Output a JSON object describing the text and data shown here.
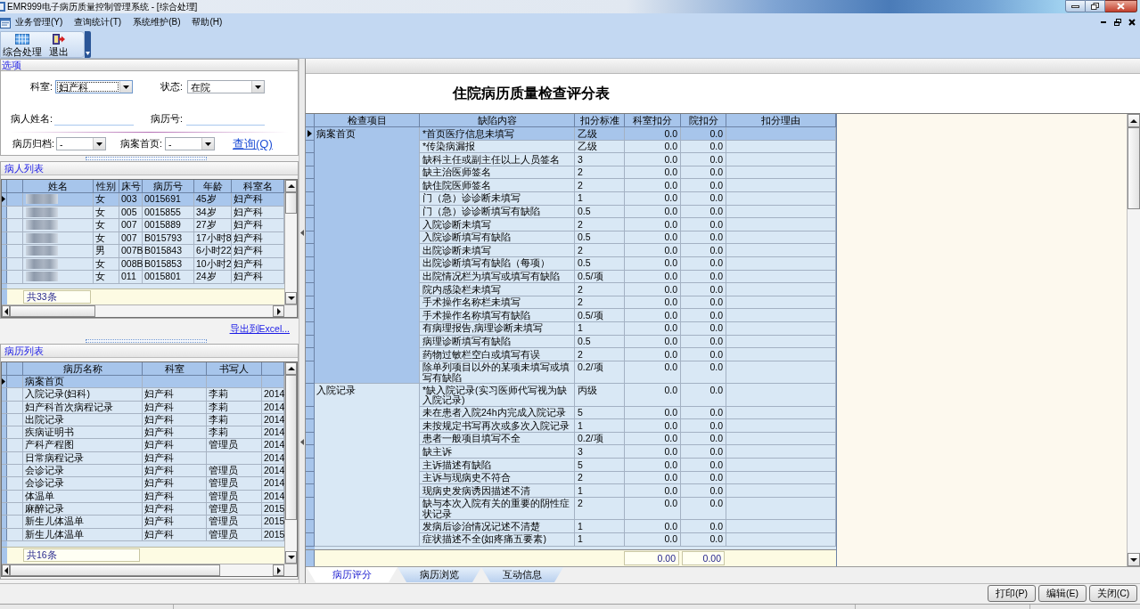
{
  "window": {
    "title": "EMR999电子病历质量控制管理系统 - [综合处理]"
  },
  "menu": [
    "业务管理(Y)",
    "查询统计(T)",
    "系统维护(B)",
    "帮助(H)"
  ],
  "toolbar": [
    {
      "kind": "grid",
      "label": "综合处理"
    },
    {
      "kind": "exit",
      "label": "退出"
    }
  ],
  "options": {
    "title": "选项",
    "dropdowns": [
      {
        "label": "科室:",
        "value": "妇产科",
        "focused": true
      },
      {
        "label": "状态:",
        "value": "在院",
        "focused": false
      },
      {
        "label": "病历归档:",
        "value": "-",
        "focused": false
      },
      {
        "label": "病案首页:",
        "value": "-",
        "focused": false
      }
    ],
    "text_fields": [
      {
        "label": "病人姓名:"
      },
      {
        "label": "病历号:"
      }
    ],
    "query_link": "查询(Q)"
  },
  "patient_list": {
    "title": "病人列表",
    "columns": [
      "姓名",
      "性别",
      "床号",
      "病历号",
      "年龄",
      "科室名"
    ],
    "rows": [
      {
        "name_blurred": true,
        "gender": "女",
        "bed": "003",
        "record_no": "0015691",
        "age": "45岁",
        "department": "妇产科",
        "selected": true
      },
      {
        "name_blurred": true,
        "gender": "女",
        "bed": "005",
        "record_no": "0015855",
        "age": "34岁",
        "department": "妇产科",
        "selected": false
      },
      {
        "name_blurred": true,
        "gender": "女",
        "bed": "007",
        "record_no": "0015889",
        "age": "27岁",
        "department": "妇产科",
        "selected": false
      },
      {
        "name_blurred": true,
        "gender": "女",
        "bed": "007",
        "record_no": "B015793",
        "age": "17小时8",
        "department": "妇产科",
        "selected": false
      },
      {
        "name_blurred": true,
        "gender": "男",
        "bed": "007B",
        "record_no": "B015843",
        "age": "6小时22",
        "department": "妇产科",
        "selected": false
      },
      {
        "name_blurred": true,
        "gender": "女",
        "bed": "008B",
        "record_no": "B015853",
        "age": "10小时2",
        "department": "妇产科",
        "selected": false
      },
      {
        "name_blurred": true,
        "gender": "女",
        "bed": "011",
        "record_no": "0015801",
        "age": "24岁",
        "department": "妇产科",
        "selected": false
      }
    ],
    "count": "共33条"
  },
  "export_link": "导出到Excel...",
  "record_list": {
    "title": "病历列表",
    "columns": [
      "病历名称",
      "科室",
      "书写人"
    ],
    "rows": [
      {
        "name": "病案首页",
        "selected": true
      },
      {
        "name": "入院记录(妇科)",
        "department": "妇产科",
        "writer": "李莉",
        "column_4": "2014",
        "selected": false
      },
      {
        "name": "妇产科首次病程记录",
        "department": "妇产科",
        "writer": "李莉",
        "column_4": "2014",
        "selected": false
      },
      {
        "name": "出院记录",
        "department": "妇产科",
        "writer": "李莉",
        "column_4": "2014",
        "selected": false
      },
      {
        "name": "疾病证明书",
        "department": "妇产科",
        "writer": "李莉",
        "column_4": "2014",
        "selected": false
      },
      {
        "name": "产科产程图",
        "department": "妇产科",
        "writer": "管理员",
        "column_4": "2014",
        "selected": false
      },
      {
        "name": "日常病程记录",
        "department": "妇产科",
        "column_4": "2014",
        "selected": false
      },
      {
        "name": "会诊记录",
        "department": "妇产科",
        "writer": "管理员",
        "column_4": "2014",
        "selected": false
      },
      {
        "name": "会诊记录",
        "department": "妇产科",
        "writer": "管理员",
        "column_4": "2014",
        "selected": false
      },
      {
        "name": "体温单",
        "department": "妇产科",
        "writer": "管理员",
        "column_4": "2014",
        "selected": false
      },
      {
        "name": "麻醉记录",
        "department": "妇产科",
        "writer": "管理员",
        "column_4": "2015",
        "selected": false
      },
      {
        "name": "新生儿体温单",
        "department": "妇产科",
        "writer": "管理员",
        "column_4": "2015",
        "selected": false
      },
      {
        "name": "新生儿体温单",
        "department": "妇产科",
        "writer": "管理员",
        "column_4": "2015",
        "selected": false
      }
    ],
    "count": "共16条"
  },
  "score_sheet": {
    "title": "住院病历质量检查评分表",
    "columns": [
      "检查项目",
      "缺陷内容",
      "扣分标准",
      "科室扣分",
      "院扣分",
      "扣分理由"
    ],
    "groups": [
      {
        "item": "病案首页",
        "rows": [
          {
            "defect": "*首页医疗信息未填写",
            "standard": "乙级",
            "dept_deduction": "0.0",
            "hospital_deduction": "0.0",
            "selected": true
          },
          {
            "defect": "*传染病漏报",
            "standard": "乙级",
            "dept_deduction": "0.0",
            "hospital_deduction": "0.0",
            "selected": false
          },
          {
            "defect": "缺科主任或副主任以上人员签名",
            "standard": "3",
            "dept_deduction": "0.0",
            "hospital_deduction": "0.0",
            "selected": false
          },
          {
            "defect": "缺主治医师签名",
            "standard": "2",
            "dept_deduction": "0.0",
            "hospital_deduction": "0.0",
            "selected": false
          },
          {
            "defect": "缺住院医师签名",
            "standard": "2",
            "dept_deduction": "0.0",
            "hospital_deduction": "0.0",
            "selected": false
          },
          {
            "defect": "门（急）诊诊断未填写",
            "standard": "1",
            "dept_deduction": "0.0",
            "hospital_deduction": "0.0",
            "selected": false
          },
          {
            "defect": "门（急）诊诊断填写有缺陷",
            "standard": "0.5",
            "dept_deduction": "0.0",
            "hospital_deduction": "0.0",
            "selected": false
          },
          {
            "defect": "入院诊断未填写",
            "standard": "2",
            "dept_deduction": "0.0",
            "hospital_deduction": "0.0",
            "selected": false
          },
          {
            "defect": "入院诊断填写有缺陷",
            "standard": "0.5",
            "dept_deduction": "0.0",
            "hospital_deduction": "0.0",
            "selected": false
          },
          {
            "defect": "出院诊断未填写",
            "standard": "2",
            "dept_deduction": "0.0",
            "hospital_deduction": "0.0",
            "selected": false
          },
          {
            "defect": "出院诊断填写有缺陷（每项）",
            "standard": "0.5",
            "dept_deduction": "0.0",
            "hospital_deduction": "0.0",
            "selected": false
          },
          {
            "defect": "出院情况栏为填写或填写有缺陷",
            "standard": "0.5/项",
            "dept_deduction": "0.0",
            "hospital_deduction": "0.0",
            "selected": false
          },
          {
            "defect": "院内感染栏未填写",
            "standard": "2",
            "dept_deduction": "0.0",
            "hospital_deduction": "0.0",
            "selected": false
          },
          {
            "defect": "手术操作名称栏未填写",
            "standard": "2",
            "dept_deduction": "0.0",
            "hospital_deduction": "0.0",
            "selected": false
          },
          {
            "defect": "手术操作名称填写有缺陷",
            "standard": "0.5/项",
            "dept_deduction": "0.0",
            "hospital_deduction": "0.0",
            "selected": false
          },
          {
            "defect": "有病理报告,病理诊断未填写",
            "standard": "1",
            "dept_deduction": "0.0",
            "hospital_deduction": "0.0",
            "selected": false
          },
          {
            "defect": "病理诊断填写有缺陷",
            "standard": "0.5",
            "dept_deduction": "0.0",
            "hospital_deduction": "0.0",
            "selected": false
          },
          {
            "defect": "药物过敏栏空白或填写有误",
            "standard": "2",
            "dept_deduction": "0.0",
            "hospital_deduction": "0.0",
            "selected": false
          },
          {
            "defect": "除单列项目以外的某项未填写或填写有缺陷",
            "standard": "0.2/项",
            "dept_deduction": "0.0",
            "hospital_deduction": "0.0",
            "selected": false
          }
        ]
      },
      {
        "item": "入院记录",
        "rows": [
          {
            "defect": "*缺入院记录(实习医师代写视为缺入院记录)",
            "standard": "丙级",
            "dept_deduction": "0.0",
            "hospital_deduction": "0.0",
            "selected": false
          },
          {
            "defect": "未在患者入院24h内完成入院记录",
            "standard": "5",
            "dept_deduction": "0.0",
            "hospital_deduction": "0.0",
            "selected": false
          },
          {
            "defect": "未按规定书写再次或多次入院记录",
            "standard": "1",
            "dept_deduction": "0.0",
            "hospital_deduction": "0.0",
            "selected": false
          },
          {
            "defect": "患者一般项目填写不全",
            "standard": "0.2/项",
            "dept_deduction": "0.0",
            "hospital_deduction": "0.0",
            "selected": false
          },
          {
            "defect": "缺主诉",
            "standard": "3",
            "dept_deduction": "0.0",
            "hospital_deduction": "0.0",
            "selected": false
          },
          {
            "defect": "主诉描述有缺陷",
            "standard": "5",
            "dept_deduction": "0.0",
            "hospital_deduction": "0.0",
            "selected": false
          },
          {
            "defect": "主诉与现病史不符合",
            "standard": "2",
            "dept_deduction": "0.0",
            "hospital_deduction": "0.0",
            "selected": false
          },
          {
            "defect": "现病史发病诱因描述不清",
            "standard": "1",
            "dept_deduction": "0.0",
            "hospital_deduction": "0.0",
            "selected": false
          },
          {
            "defect": "缺与本次入院有关的重要的阴性症状记录",
            "standard": "2",
            "dept_deduction": "0.0",
            "hospital_deduction": "0.0",
            "selected": false
          },
          {
            "defect": "发病后诊治情况记述不清楚",
            "standard": "1",
            "dept_deduction": "0.0",
            "hospital_deduction": "0.0",
            "selected": false
          },
          {
            "defect": "症状描述不全(如疼痛五要素)",
            "standard": "1",
            "dept_deduction": "0.0",
            "hospital_deduction": "0.0",
            "selected": false
          }
        ]
      }
    ],
    "totals": [
      "0.00",
      "0.00"
    ]
  },
  "tabs": [
    {
      "label": "病历评分",
      "selected": true
    },
    {
      "label": "病历浏览",
      "selected": false
    },
    {
      "label": "互动信息",
      "selected": false
    }
  ],
  "buttons": [
    "打印(P)",
    "编辑(E)",
    "关闭(C)"
  ]
}
